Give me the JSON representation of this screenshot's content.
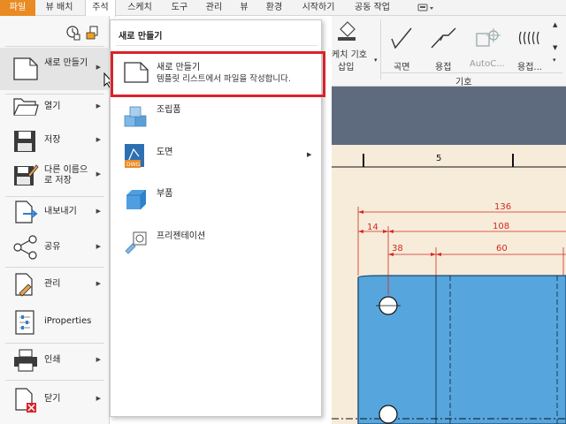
{
  "menubar": {
    "tabs": [
      "파일",
      "뷰 배치",
      "주석",
      "스케치",
      "도구",
      "관리",
      "뷰",
      "환경",
      "시작하기",
      "공동 작업"
    ]
  },
  "ribbon": {
    "sketch_symbol_line1": "케치 기호",
    "sketch_symbol_line2": "삽입",
    "buttons": [
      "곡면",
      "용접",
      "AutoC...",
      "용접..."
    ],
    "group_label": "기호"
  },
  "sheet": {
    "zone_number": "5",
    "dims": [
      "136",
      "14",
      "108",
      "38",
      "60"
    ]
  },
  "file_menu": {
    "items": [
      {
        "label": "새로 만들기",
        "has_arrow": true
      },
      {
        "label": "열기",
        "has_arrow": true
      },
      {
        "label": "저장",
        "has_arrow": true
      },
      {
        "label": "다른 이름으로 저장",
        "has_arrow": true
      },
      {
        "label": "내보내기",
        "has_arrow": true
      },
      {
        "label": "공유",
        "has_arrow": true
      },
      {
        "label": "관리",
        "has_arrow": true
      },
      {
        "label": "iProperties",
        "has_arrow": false
      },
      {
        "label": "인쇄",
        "has_arrow": true
      },
      {
        "label": "닫기",
        "has_arrow": true
      }
    ]
  },
  "new_panel": {
    "title": "새로 만들기",
    "items": [
      {
        "label": "새로 만들기",
        "description": "템플릿 리스트에서 파일을 작성합니다."
      },
      {
        "label": "조립품"
      },
      {
        "label": "도면",
        "has_arrow": true
      },
      {
        "label": "부품"
      },
      {
        "label": "프리젠테이션"
      }
    ]
  },
  "colors": {
    "active_tab": "#e98b23",
    "highlight_border": "#d8232a",
    "part_fill": "#56a5dc",
    "dimension_red": "#d42a24"
  }
}
